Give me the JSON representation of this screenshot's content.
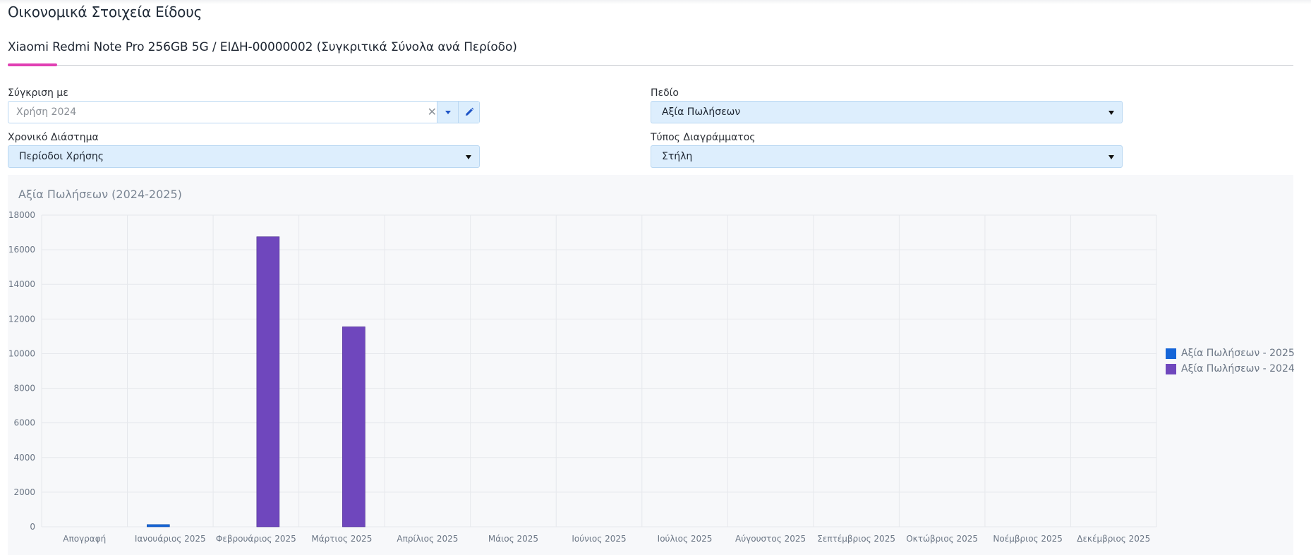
{
  "page": {
    "title": "Οικονομικά Στοιχεία Είδους",
    "subtitle": "Xiaomi Redmi Note Pro 256GB 5G / ΕΙΔΗ-00000002 (Συγκριτικά Σύνολα ανά Περίοδο)"
  },
  "filters": {
    "compare_label": "Σύγκριση με",
    "compare_value": "Χρήση 2024",
    "field_label": "Πεδίο",
    "field_value": "Αξία Πωλήσεων",
    "period_label": "Χρονικό Διάστημα",
    "period_value": "Περίοδοι Χρήσης",
    "chart_type_label": "Τύπος Διαγράμματος",
    "chart_type_value": "Στήλη"
  },
  "icons": {
    "clear": "close-icon",
    "dropdown": "caret-down-icon",
    "edit": "pencil-icon"
  },
  "chart_data": {
    "type": "bar",
    "title": "Αξία Πωλήσεων (2024-2025)",
    "categories": [
      "Απογραφή",
      "Ιανουάριος 2025",
      "Φεβρουάριος 2025",
      "Μάρτιος 2025",
      "Απρίλιος 2025",
      "Μάιος 2025",
      "Ιούνιος 2025",
      "Ιούλιος 2025",
      "Αύγουστος 2025",
      "Σεπτέμβριος 2025",
      "Οκτώβριος 2025",
      "Νοέμβριος 2025",
      "Δεκέμβριος 2025"
    ],
    "series": [
      {
        "name": "Αξία Πωλήσεων - 2025",
        "color": "#1565d8",
        "values": [
          0,
          130,
          0,
          0,
          0,
          0,
          0,
          0,
          0,
          0,
          0,
          0,
          0
        ]
      },
      {
        "name": "Αξία Πωλήσεων - 2024",
        "color": "#6f47bd",
        "values": [
          0,
          0,
          16750,
          11550,
          0,
          0,
          0,
          0,
          0,
          0,
          0,
          0,
          0
        ]
      }
    ],
    "ylim": [
      0,
      18000
    ],
    "yticks": [
      0,
      2000,
      4000,
      6000,
      8000,
      10000,
      12000,
      14000,
      16000,
      18000
    ],
    "grid": true,
    "legend_position": "right"
  }
}
